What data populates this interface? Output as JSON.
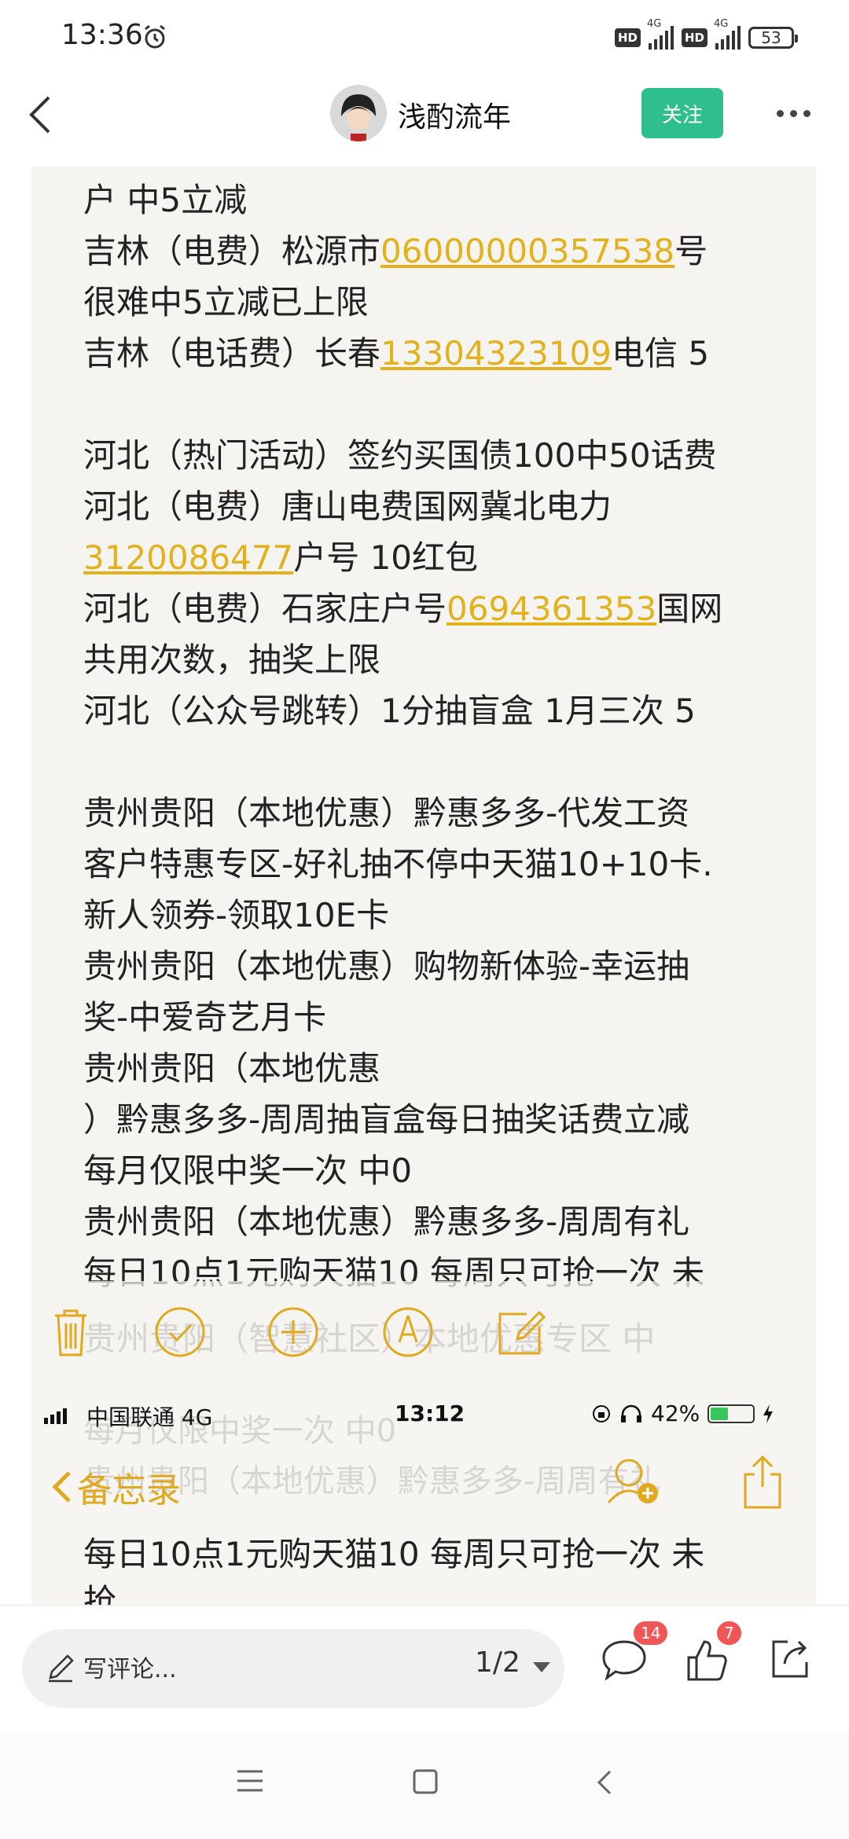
{
  "status_bar": {
    "time": "13:36",
    "network_1": "4G",
    "network_2": "4G",
    "hd_label": "HD",
    "battery": "53",
    "icons": [
      "alarm-icon",
      "hd-icon",
      "signal-icon",
      "battery-icon"
    ]
  },
  "header": {
    "author": "浅酌流年",
    "follow_label": "关注",
    "accent_color": "#2fbf8f"
  },
  "note": {
    "lines": [
      [
        {
          "t": "户 中5立减"
        }
      ],
      [
        {
          "t": "吉林（电费）松源市"
        },
        {
          "t": "06000000357538",
          "link": true
        },
        {
          "t": "号"
        }
      ],
      [
        {
          "t": "很难中5立减已上限"
        }
      ],
      [
        {
          "t": "吉林（电话费）长春"
        },
        {
          "t": "13304323109",
          "link": true
        },
        {
          "t": "电信 5"
        }
      ],
      [],
      [
        {
          "t": "河北（热门活动）签约买国债100中50话费"
        }
      ],
      [
        {
          "t": "河北（电费）唐山电费国网冀北电力"
        }
      ],
      [
        {
          "t": "3120086477",
          "link": true
        },
        {
          "t": "户号 10红包"
        }
      ],
      [
        {
          "t": "河北（电费）石家庄户号"
        },
        {
          "t": "0694361353",
          "link": true
        },
        {
          "t": "国网"
        }
      ],
      [
        {
          "t": "共用次数，抽奖上限"
        }
      ],
      [
        {
          "t": "河北（公众号跳转）1分抽盲盒 1月三次 5"
        }
      ],
      [],
      [
        {
          "t": "贵州贵阳（本地优惠）黔惠多多-代发工资"
        }
      ],
      [
        {
          "t": "客户特惠专区-好礼抽不停中天猫10+10卡."
        }
      ],
      [
        {
          "t": "新人领券-领取10E卡"
        }
      ],
      [
        {
          "t": "贵州贵阳（本地优惠）购物新体验-幸运抽"
        }
      ],
      [
        {
          "t": "奖-中爱奇艺月卡"
        }
      ],
      [
        {
          "t": "贵州贵阳（本地优惠"
        }
      ],
      [
        {
          "t": "）黔惠多多-周周抽盲盒每日抽奖话费立减"
        }
      ],
      [
        {
          "t": "每月仅限中奖一次  中0"
        }
      ],
      [
        {
          "t": "贵州贵阳（本地优惠）黔惠多多-周周有礼"
        }
      ],
      [
        {
          "t": "每日10点1元购天猫10 每周只可抢一次  未"
        }
      ]
    ],
    "ghost_lines": [
      "贵州贵阳（智慧社区）本地优惠专区 中",
      "每月仅限中奖一次  中0",
      "贵州贵阳（本地优惠）黔惠多多-周周有礼"
    ],
    "link_color": "#e2b21c",
    "toolbar_icons": [
      "trash-icon",
      "check-circle-icon",
      "add-circle-icon",
      "markup-pen-icon",
      "compose-icon"
    ]
  },
  "screenshot2": {
    "carrier": "中国联通",
    "network": "4G",
    "time": "13:12",
    "battery": "42%",
    "back_label": "备忘录",
    "text_lines": [
      "每日10点1元购天猫10 每周只可抢一次  未",
      "抢"
    ],
    "battery_level": 0.42
  },
  "comment_bar": {
    "placeholder": "写评论...",
    "page_indicator": "1/2",
    "comment_count": "14",
    "like_count": "7",
    "icons": [
      "pen-icon",
      "comment-icon",
      "like-icon",
      "share-icon"
    ]
  },
  "nav_bar": {
    "icons": [
      "menu-icon",
      "home-icon",
      "back-icon"
    ]
  }
}
